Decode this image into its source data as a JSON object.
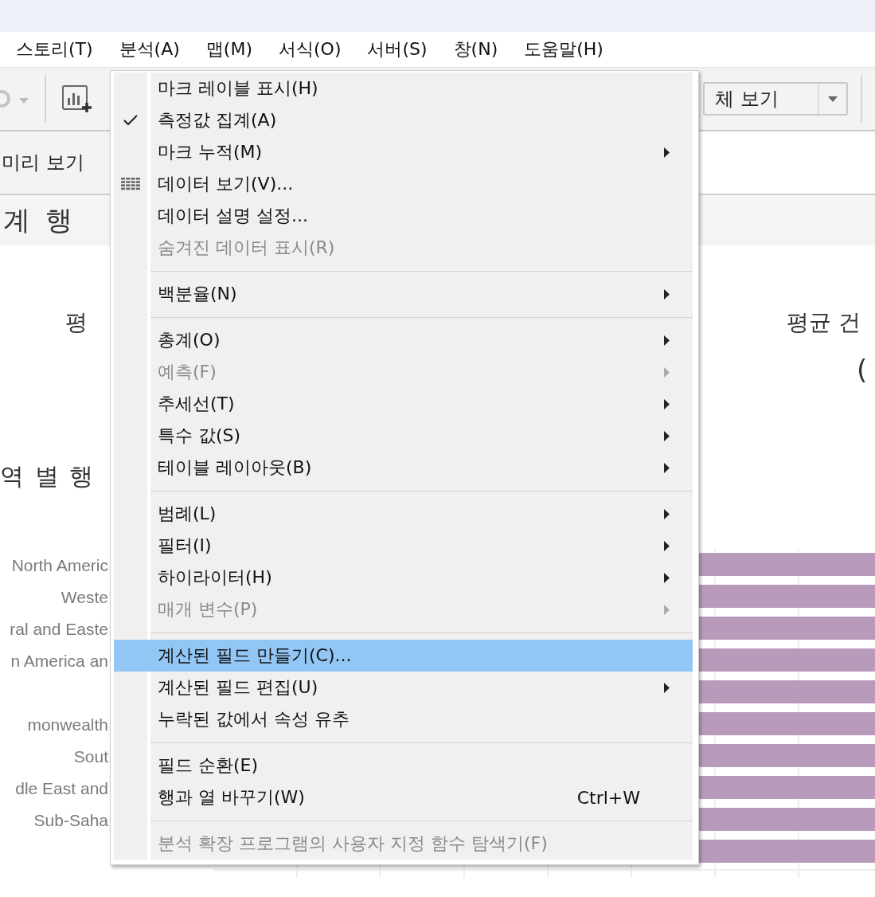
{
  "menu_bar": [
    {
      "label": "스토리(T)"
    },
    {
      "label": "분석(A)"
    },
    {
      "label": "맵(M)"
    },
    {
      "label": "서식(O)"
    },
    {
      "label": "서버(S)"
    },
    {
      "label": "창(N)"
    },
    {
      "label": "도움말(H)"
    }
  ],
  "toolbar": {
    "view_dropdown": "체 보기"
  },
  "preview_label": "미리 보기",
  "sheet_title": "계 행",
  "kpis": [
    {
      "label": "평"
    },
    {
      "label": "평균 건",
      "value": "("
    }
  ],
  "section_title": "역 별 행",
  "region_rows": [
    {
      "label": "North Americ"
    },
    {
      "label": "Weste"
    },
    {
      "label": "ral and Easte"
    },
    {
      "label": "n America an"
    },
    {},
    {
      "label": "monwealth"
    },
    {
      "label": "Sout"
    },
    {
      "label": "dle East and"
    },
    {
      "label": "Sub-Saha"
    },
    {}
  ],
  "context_menu": {
    "items": [
      {
        "kind": "item",
        "label": "마크 레이블 표시(H)",
        "checked": false,
        "disabled": false,
        "submenu": false,
        "selected": false
      },
      {
        "kind": "item",
        "label": "측정값 집계(A)",
        "checked": true,
        "disabled": false,
        "submenu": false,
        "selected": false
      },
      {
        "kind": "item",
        "label": "마크 누적(M)",
        "checked": false,
        "disabled": false,
        "submenu": true,
        "selected": false
      },
      {
        "kind": "grid_item",
        "label": "데이터 보기(V)...",
        "checked": false,
        "disabled": false,
        "submenu": false,
        "selected": false
      },
      {
        "kind": "item",
        "label": "데이터 설명 설정...",
        "checked": false,
        "disabled": false,
        "submenu": false,
        "selected": false
      },
      {
        "kind": "item",
        "label": "숨겨진 데이터 표시(R)",
        "checked": false,
        "disabled": true,
        "submenu": false,
        "selected": false
      },
      {
        "kind": "separator"
      },
      {
        "kind": "item",
        "label": "백분율(N)",
        "checked": false,
        "disabled": false,
        "submenu": true,
        "selected": false
      },
      {
        "kind": "separator"
      },
      {
        "kind": "item",
        "label": "총계(O)",
        "checked": false,
        "disabled": false,
        "submenu": true,
        "selected": false
      },
      {
        "kind": "item",
        "label": "예측(F)",
        "checked": false,
        "disabled": true,
        "submenu": true,
        "selected": false
      },
      {
        "kind": "item",
        "label": "추세선(T)",
        "checked": false,
        "disabled": false,
        "submenu": true,
        "selected": false
      },
      {
        "kind": "item",
        "label": "특수 값(S)",
        "checked": false,
        "disabled": false,
        "submenu": true,
        "selected": false
      },
      {
        "kind": "item",
        "label": "테이블 레이아웃(B)",
        "checked": false,
        "disabled": false,
        "submenu": true,
        "selected": false
      },
      {
        "kind": "separator"
      },
      {
        "kind": "item",
        "label": "범례(L)",
        "checked": false,
        "disabled": false,
        "submenu": true,
        "selected": false
      },
      {
        "kind": "item",
        "label": "필터(I)",
        "checked": false,
        "disabled": false,
        "submenu": true,
        "selected": false
      },
      {
        "kind": "item",
        "label": "하이라이터(H)",
        "checked": false,
        "disabled": false,
        "submenu": true,
        "selected": false
      },
      {
        "kind": "item",
        "label": "매개 변수(P)",
        "checked": false,
        "disabled": true,
        "submenu": true,
        "selected": false
      },
      {
        "kind": "separator"
      },
      {
        "kind": "item",
        "label": "계산된 필드 만들기(C)...",
        "checked": false,
        "disabled": false,
        "submenu": false,
        "selected": true
      },
      {
        "kind": "item",
        "label": "계산된 필드 편집(U)",
        "checked": false,
        "disabled": false,
        "submenu": true,
        "selected": false
      },
      {
        "kind": "item",
        "label": "누락된 값에서 속성 유추",
        "checked": false,
        "disabled": false,
        "submenu": false,
        "selected": false
      },
      {
        "kind": "separator"
      },
      {
        "kind": "item",
        "label": "필드 순환(E)",
        "checked": false,
        "disabled": false,
        "submenu": false,
        "selected": false
      },
      {
        "kind": "item",
        "label": "행과 열 바꾸기(W)",
        "checked": false,
        "disabled": false,
        "submenu": false,
        "selected": false,
        "shortcut": "Ctrl+W"
      },
      {
        "kind": "separator"
      },
      {
        "kind": "item",
        "label": "분석 확장 프로그램의 사용자 지정 함수 탐색기(F)",
        "checked": false,
        "disabled": true,
        "submenu": false,
        "selected": false
      }
    ]
  }
}
